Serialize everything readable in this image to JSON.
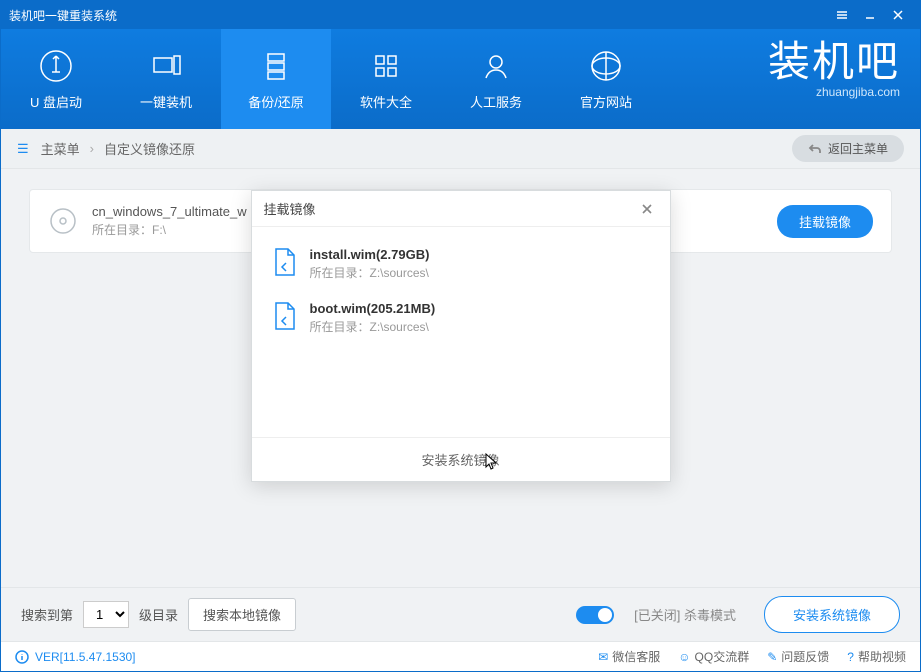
{
  "titlebar": {
    "title": "装机吧一键重装系统"
  },
  "nav": {
    "items": [
      {
        "label": "U 盘启动"
      },
      {
        "label": "一键装机"
      },
      {
        "label": "备份/还原"
      },
      {
        "label": "软件大全"
      },
      {
        "label": "人工服务"
      },
      {
        "label": "官方网站"
      }
    ]
  },
  "logo": {
    "text": "装机吧",
    "sub": "zhuangjiba.com"
  },
  "breadcrumb": {
    "root": "主菜单",
    "current": "自定义镜像还原",
    "back": "返回主菜单"
  },
  "image_row": {
    "name": "cn_windows_7_ultimate_w",
    "path_label": "所在目录：F:\\",
    "mount_btn": "挂载镜像"
  },
  "bottom": {
    "search_prefix": "搜索到第",
    "level_value": "1",
    "level_suffix": "级目录",
    "search_btn": "搜索本地镜像",
    "av_status": "[已关闭] 杀毒模式",
    "install_btn": "安装系统镜像"
  },
  "status": {
    "version": "VER[11.5.47.1530]",
    "links": [
      {
        "label": "微信客服"
      },
      {
        "label": "QQ交流群"
      },
      {
        "label": "问题反馈"
      },
      {
        "label": "帮助视频"
      }
    ]
  },
  "modal": {
    "title": "挂载镜像",
    "items": [
      {
        "name": "install.wim(2.79GB)",
        "path": "所在目录：Z:\\sources\\"
      },
      {
        "name": "boot.wim(205.21MB)",
        "path": "所在目录：Z:\\sources\\"
      }
    ],
    "footer": "安装系统镜像"
  }
}
